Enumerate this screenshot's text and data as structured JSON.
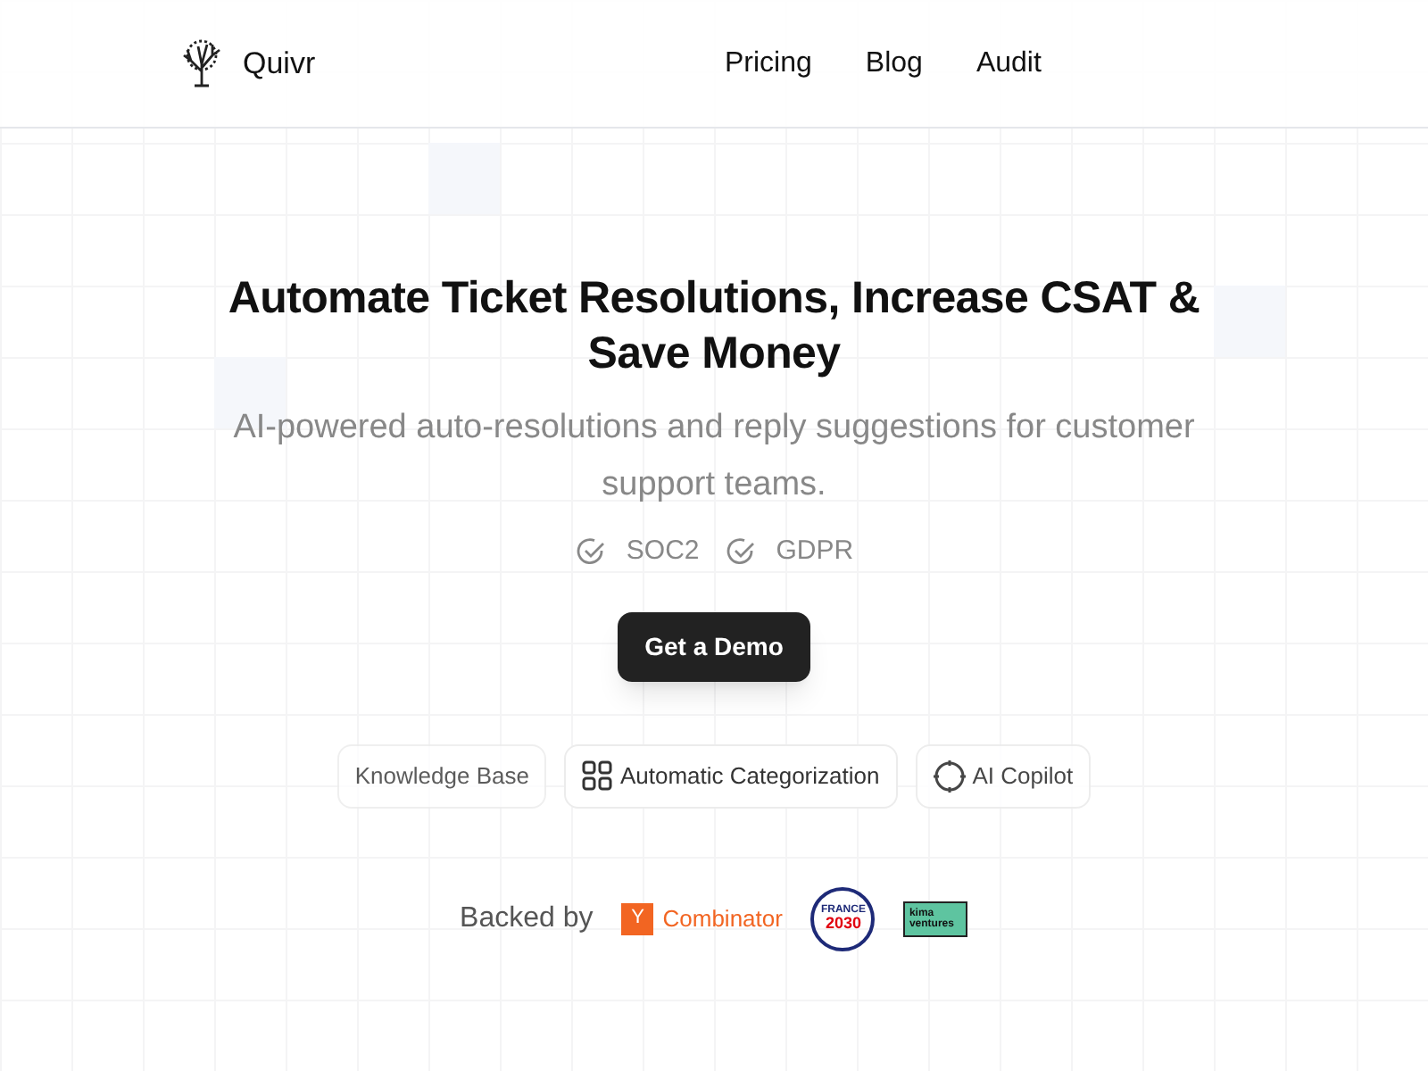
{
  "header": {
    "brand": "Quivr",
    "nav": [
      "Pricing",
      "Blog",
      "Audit"
    ]
  },
  "hero": {
    "title": "Automate Ticket Resolutions, Increase CSAT & Save Money",
    "subtitle": "AI-powered auto-resolutions and reply suggestions for customer support teams.",
    "badges": [
      "SOC2",
      "GDPR"
    ],
    "cta": "Get a Demo"
  },
  "features": [
    {
      "label": "Knowledge Base",
      "kind": "none"
    },
    {
      "label": "Automatic Categorization",
      "kind": "grid"
    },
    {
      "label": "AI Copilot",
      "kind": "target"
    }
  ],
  "backers": {
    "label": "Backed by",
    "yc_mark": "Y",
    "yc_name": "Combinator",
    "france": [
      "FRANCE",
      "2030"
    ],
    "kima": [
      "kima",
      "ventures"
    ]
  }
}
